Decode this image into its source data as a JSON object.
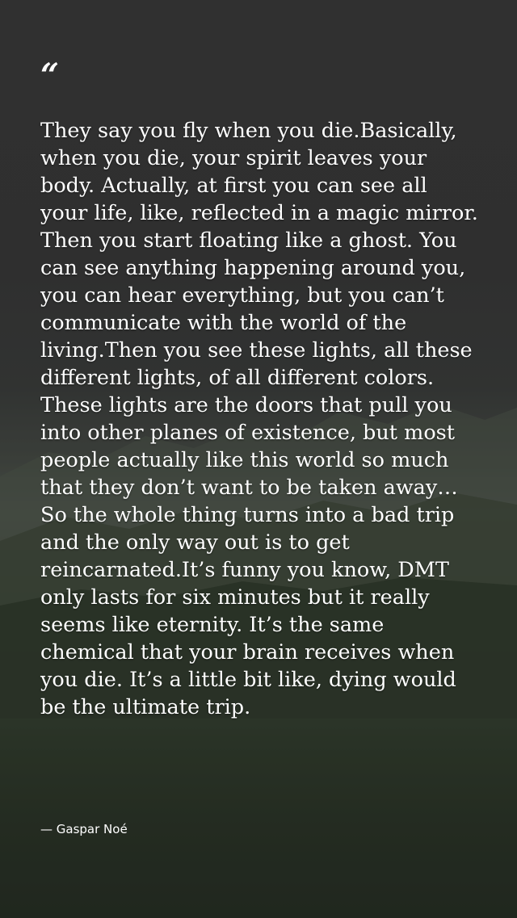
{
  "quote": {
    "mark": "“",
    "text": "They say you fly when you die.Basically, when you die, your spirit leaves your body. Actually, at first you can see all your life, like, reflected in a magic mirror. Then you start floating like a ghost. You can see anything happening around you, you can hear everything, but you can’t communicate with the world of the living.Then you see these lights, all these different lights, of all different colors. These lights are the doors that pull you into other planes of existence, but most people actually like this world so much that they don’t want to be taken away… So the whole thing turns into a bad trip and the only way out is to get reincarnated.It’s funny you know, DMT only lasts for six minutes but it really seems like eternity. It’s the same chemical that your brain receives when you die. It’s a little bit like, dying would be the ultimate trip.",
    "author": "— Gaspar Noé"
  },
  "colors": {
    "text": "#ffffff",
    "background_top": "#3a3a3a",
    "background_bottom": "#232d20"
  }
}
